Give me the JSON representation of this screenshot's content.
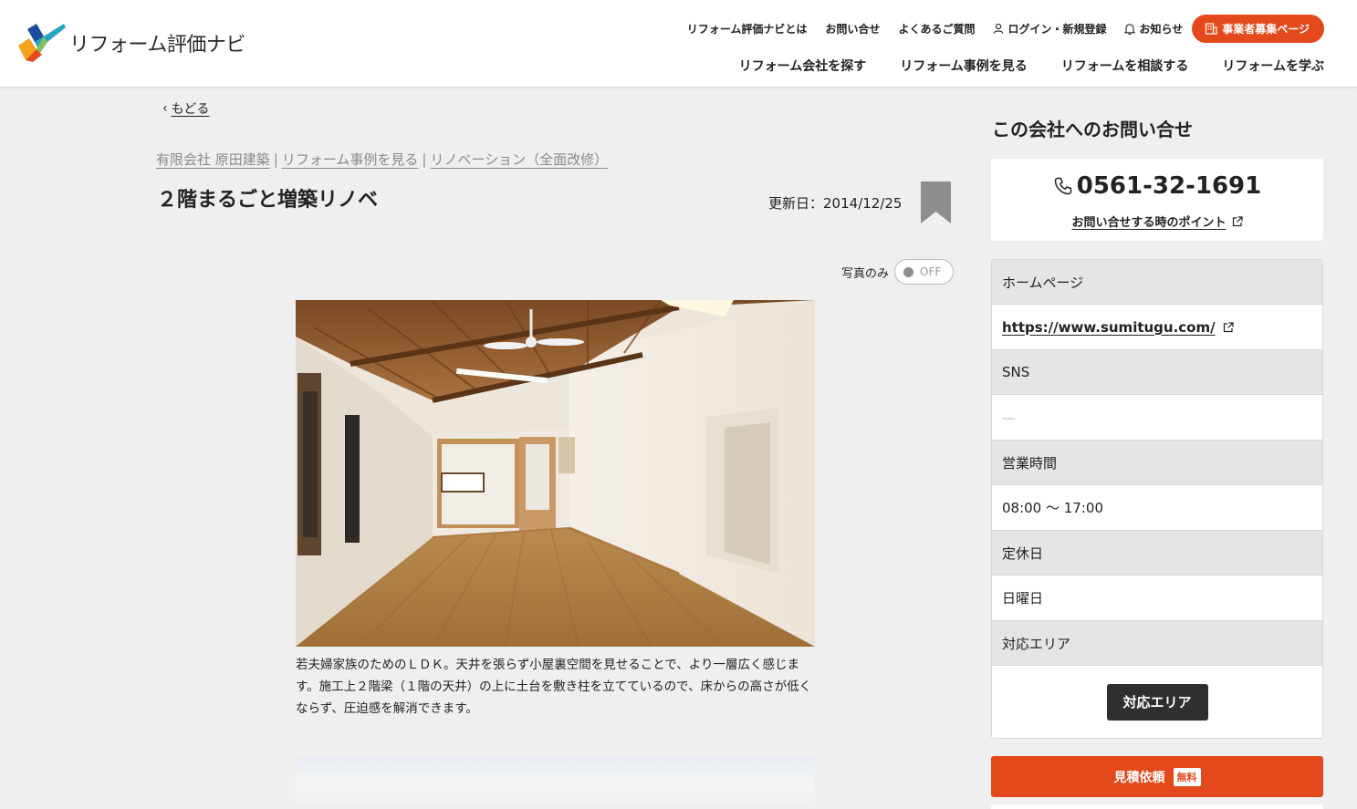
{
  "header": {
    "logo_text": "リフォーム評価ナビ",
    "util_links": [
      {
        "label": "リフォーム評価ナビとは",
        "icon": ""
      },
      {
        "label": "お問い合せ",
        "icon": ""
      },
      {
        "label": "よくあるご質問",
        "icon": ""
      },
      {
        "label": "ログイン・新規登録",
        "icon": "user-icon"
      },
      {
        "label": "お知らせ",
        "icon": "bell-icon"
      }
    ],
    "biz_button": {
      "label": "事業者募集ページ",
      "icon": "building-icon"
    },
    "main_nav": [
      {
        "label": "リフォーム会社を探す"
      },
      {
        "label": "リフォーム事例を見る"
      },
      {
        "label": "リフォームを相談する"
      },
      {
        "label": "リフォームを学ぶ"
      }
    ]
  },
  "back_link": {
    "label": "もどる"
  },
  "breadcrumb": [
    {
      "label": "有限会社 原田建築"
    },
    {
      "label": "リフォーム事例を見る"
    },
    {
      "label": "リノベーション（全面改修）"
    }
  ],
  "breadcrumb_separator": "|",
  "case": {
    "title": "２階まるごと増築リノベ",
    "updated_label": "更新日：",
    "updated_date": "2014/12/25",
    "photo_only": {
      "label": "写真のみ",
      "state": "OFF"
    },
    "photos": [
      {
        "caption": "若夫婦家族のためのＬＤＫ。天井を張らず小屋裏空間を見せることで、より一層広く感じます。施工上２階梁（１階の天井）の上に土台を敷き柱を立てているので、床からの高さが低くならず、圧迫感を解消できます。"
      },
      {
        "caption": ""
      }
    ]
  },
  "sidebar": {
    "heading": "この会社へのお問い合せ",
    "phone": "0561-32-1691",
    "phone_tips": "お問い合せする時のポイント",
    "info": {
      "homepage_label": "ホームページ",
      "homepage_url": "https://www.sumitugu.com/",
      "sns_label": "SNS",
      "sns_value": "—",
      "hours_label": "営業時間",
      "hours_value": "08:00 〜 17:00",
      "holiday_label": "定休日",
      "holiday_value": "日曜日",
      "area_label": "対応エリア",
      "area_button": "対応エリア"
    },
    "estimate_button": "見積依頼",
    "free_badge": "無料"
  },
  "colors": {
    "accent": "#e4491c",
    "background": "#efefef",
    "dark_button": "#2f2f2f",
    "breadcrumb": "#8a8a8a"
  }
}
